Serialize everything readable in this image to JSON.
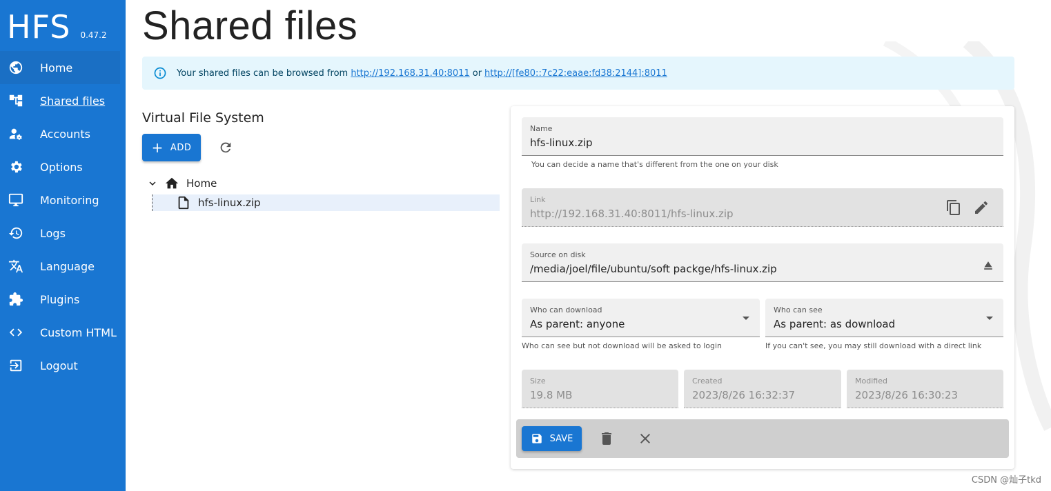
{
  "brand": {
    "title": "HFS",
    "version": "0.47.2"
  },
  "nav": [
    {
      "label": "Home",
      "icon": "globe-icon"
    },
    {
      "label": "Shared files",
      "icon": "tree-icon"
    },
    {
      "label": "Accounts",
      "icon": "accounts-icon"
    },
    {
      "label": "Options",
      "icon": "gear-icon"
    },
    {
      "label": "Monitoring",
      "icon": "monitor-icon"
    },
    {
      "label": "Logs",
      "icon": "history-icon"
    },
    {
      "label": "Language",
      "icon": "translate-icon"
    },
    {
      "label": "Plugins",
      "icon": "puzzle-icon"
    },
    {
      "label": "Custom HTML",
      "icon": "code-icon"
    },
    {
      "label": "Logout",
      "icon": "logout-icon"
    }
  ],
  "page": {
    "title": "Shared files"
  },
  "info": {
    "text": "Your shared files can be browsed from",
    "link1": "http://192.168.31.40:8011",
    "or": "or",
    "link2": "http://[fe80::7c22:eaae:fd38:2144]:8011"
  },
  "vfs": {
    "title": "Virtual File System",
    "add_label": "ADD",
    "root": "Home",
    "child": "hfs-linux.zip"
  },
  "details": {
    "name": {
      "label": "Name",
      "value": "hfs-linux.zip",
      "helper": "You can decide a name that's different from the one on your disk"
    },
    "link": {
      "label": "Link",
      "value": "http://192.168.31.40:8011/hfs-linux.zip"
    },
    "source": {
      "label": "Source on disk",
      "value": "/media/joel/file/ubuntu/soft packge/hfs-linux.zip"
    },
    "download": {
      "label": "Who can download",
      "value": "As parent: anyone",
      "helper": "Who can see but not download will be asked to login"
    },
    "see": {
      "label": "Who can see",
      "value": "As parent: as download",
      "helper": "If you can't see, you may still download with a direct link"
    },
    "size": {
      "label": "Size",
      "value": "19.8 MB"
    },
    "created": {
      "label": "Created",
      "value": "2023/8/26 16:32:37"
    },
    "modified": {
      "label": "Modified",
      "value": "2023/8/26 16:30:23"
    },
    "save_label": "SAVE"
  },
  "watermark": "CSDN @灿子tkd",
  "colors": {
    "primary": "#1976d2",
    "info_bg": "#e5f6fd",
    "info_icon": "#0288d1"
  }
}
